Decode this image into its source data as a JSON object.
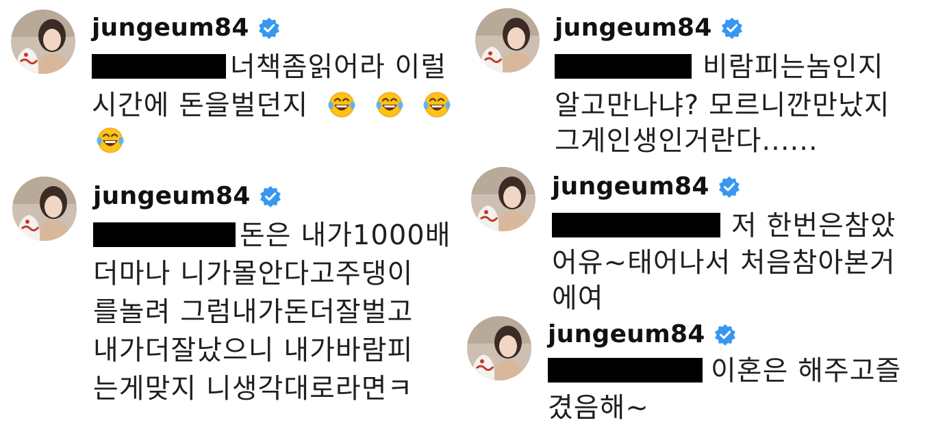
{
  "comments": [
    {
      "username": "jungeum84",
      "lines": [
        "너책좀읽어라 이럴",
        "시간에 돈을벌던지"
      ],
      "emoji": "face-with-tears-of-joy-icon"
    },
    {
      "username": "jungeum84",
      "lines": [
        "비람피는놈인지",
        "알고만나냐? 모르니깐만났지",
        "그게인생인거란다......"
      ]
    },
    {
      "username": "jungeum84",
      "lines": [
        "돈은 내가1000배",
        "더마나 니가몰안다고주댕이",
        "를놀려 그럼내가돈더잘벌고",
        "내가더잘났으니 내가바람피",
        "는게맞지 니생각대로라면ㅋ"
      ]
    },
    {
      "username": "jungeum84",
      "lines": [
        "저 한번은참았",
        "어유~태어나서 처음참아본거",
        "에여"
      ]
    },
    {
      "username": "jungeum84",
      "lines": [
        "이혼은 해주고즐",
        "겼음해~"
      ]
    }
  ],
  "colors": {
    "verified_badge": "#3897f0",
    "redaction": "#000000",
    "text": "#1f1f1f"
  }
}
